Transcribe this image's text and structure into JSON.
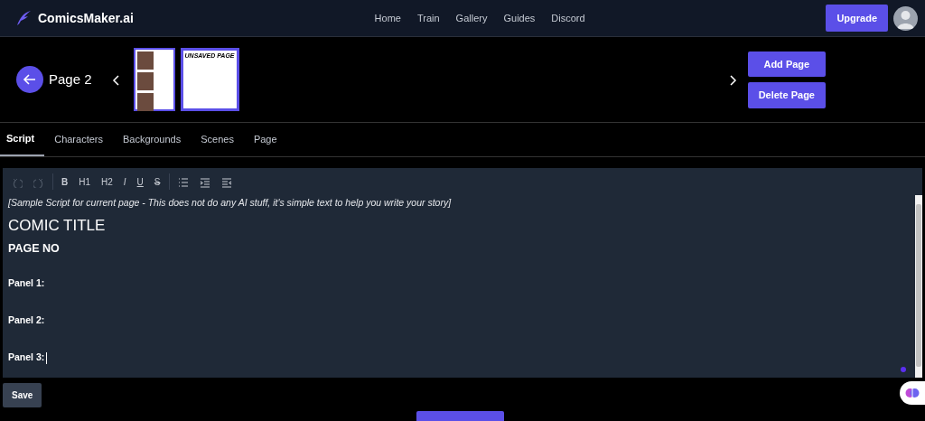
{
  "navbar": {
    "brand": "ComicsMaker.ai",
    "links": [
      "Home",
      "Train",
      "Gallery",
      "Guides",
      "Discord"
    ],
    "upgrade": "Upgrade"
  },
  "page_bar": {
    "title": "Page 2",
    "thumbnails": [
      {
        "selected": false,
        "kind": "art"
      },
      {
        "selected": true,
        "kind": "blank",
        "text": "UNSAVED PAGE"
      }
    ],
    "buttons": [
      "Add Page",
      "Delete Page"
    ]
  },
  "tabs": [
    {
      "label": "Script",
      "selected": true
    },
    {
      "label": "Characters",
      "selected": false
    },
    {
      "label": "Backgrounds",
      "selected": false
    },
    {
      "label": "Scenes",
      "selected": false
    },
    {
      "label": "Page",
      "selected": false
    }
  ],
  "toolbar": [
    {
      "kind": "undo",
      "disabled": true
    },
    {
      "kind": "redo",
      "disabled": true
    },
    {
      "kind": "bold",
      "label": "B",
      "disabled": false
    },
    {
      "kind": "h1",
      "label": "H1",
      "disabled": false
    },
    {
      "kind": "h2",
      "label": "H2",
      "disabled": false
    },
    {
      "kind": "italic",
      "label": "I",
      "disabled": false
    },
    {
      "kind": "underline",
      "label": "U",
      "disabled": false
    },
    {
      "kind": "strike",
      "label": "S",
      "disabled": false
    },
    {
      "kind": "list",
      "disabled": false
    },
    {
      "kind": "indent",
      "disabled": false
    },
    {
      "kind": "outdent",
      "disabled": false
    }
  ],
  "editor_content": [
    {
      "kind": "note",
      "text": "[Sample Script for current page - This does not do any AI stuff, it's simple text to help you write your story]"
    },
    {
      "kind": "title",
      "text": "COMIC TITLE"
    },
    {
      "kind": "heading",
      "text": "PAGE NO"
    },
    {
      "kind": "panel",
      "text": "Panel 1:"
    },
    {
      "kind": "panel",
      "text": "Panel 2:"
    },
    {
      "kind": "panel",
      "text": "Panel 3:",
      "cursor": true
    }
  ],
  "save": "Save"
}
